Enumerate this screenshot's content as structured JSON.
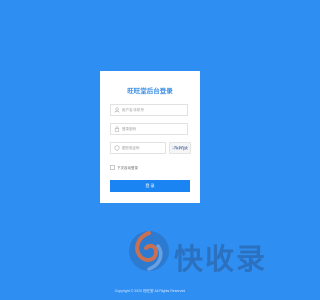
{
  "login": {
    "title": "旺旺堂后台登录",
    "username_placeholder": "用户名/手机号",
    "password_placeholder": "登录密码",
    "captcha_placeholder": "图形验证码",
    "captcha_text": "7kWpk",
    "remember_label": "下次自动登录",
    "login_button": "登 录"
  },
  "watermark": {
    "text": "快收录"
  },
  "footer": {
    "copyright": "Copyright © 2020 旺旺堂 All Rights Reserved"
  },
  "colors": {
    "background": "#2f8ef2",
    "accent": "#1a84f3"
  },
  "icons": {
    "username": "user-icon",
    "password": "lock-icon",
    "captcha": "shield-icon",
    "logo": "swirl-logo-icon"
  }
}
